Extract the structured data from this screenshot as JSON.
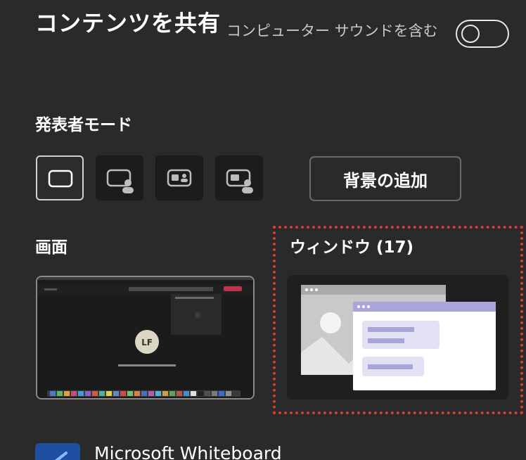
{
  "header": {
    "title": "コンテンツを共有",
    "include_sound_label": "コンピューター サウンドを含む",
    "include_sound_enabled": false
  },
  "presenter_mode": {
    "label": "発表者モード",
    "modes": [
      {
        "name": "content-only",
        "selected": true
      },
      {
        "name": "standout",
        "selected": false
      },
      {
        "name": "side-by-side",
        "selected": false
      },
      {
        "name": "reporter",
        "selected": false
      }
    ],
    "add_background_label": "背景の追加"
  },
  "sources": {
    "screen_label": "画面",
    "window_label": "ウィンドウ (17)",
    "screen_avatar_initials": "LF"
  },
  "apps": [
    {
      "label": "Microsoft Whiteboard",
      "icon": "whiteboard-icon"
    }
  ],
  "colors": {
    "background": "#2a2a2a",
    "highlight": "#e0392f",
    "window_accent": "#a9a5d8"
  }
}
